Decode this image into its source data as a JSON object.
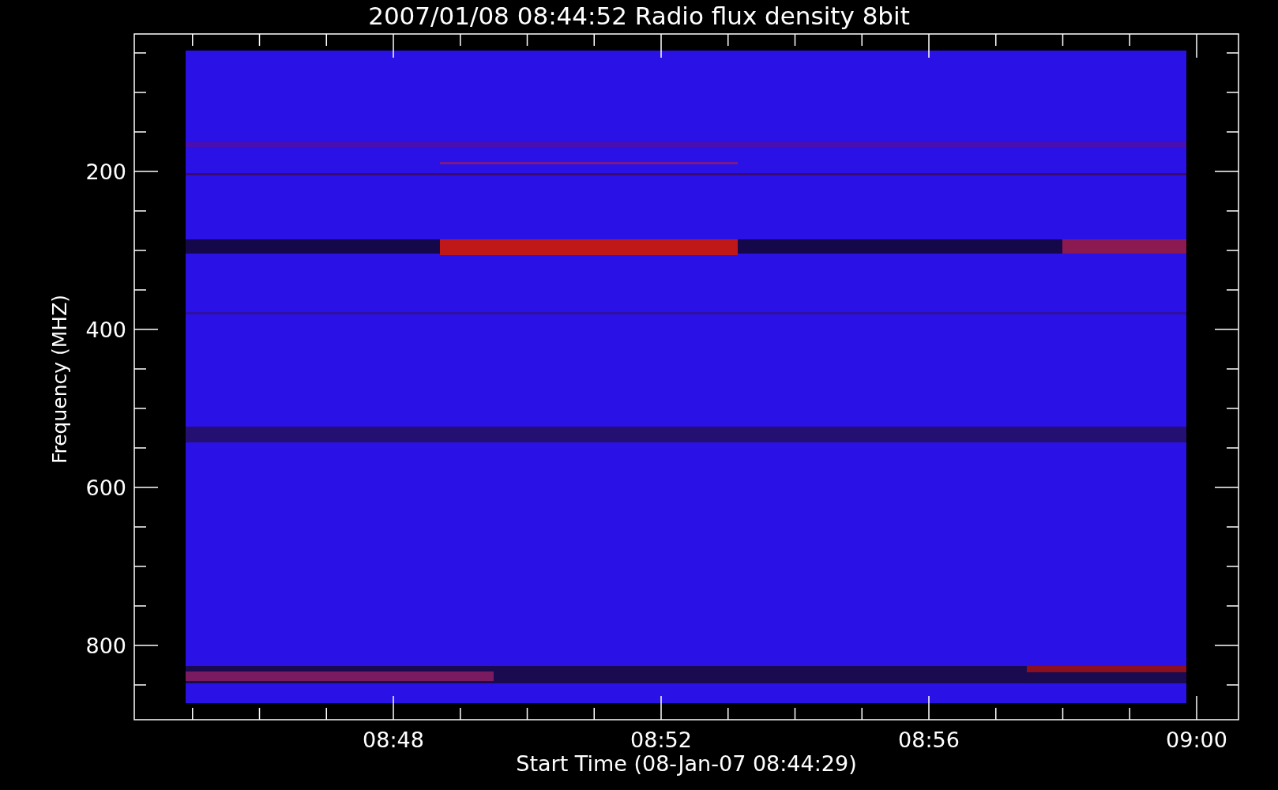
{
  "title": "2007/01/08 08:44:52 Radio flux density 8bit",
  "y_axis": {
    "label": "Frequency (MHZ)",
    "ticks": [
      "200",
      "400",
      "600",
      "800"
    ]
  },
  "x_axis": {
    "label": "Start Time (08-Jan-07 08:44:29)",
    "ticks": [
      "08:48",
      "08:52",
      "08:56",
      "09:00"
    ]
  }
}
